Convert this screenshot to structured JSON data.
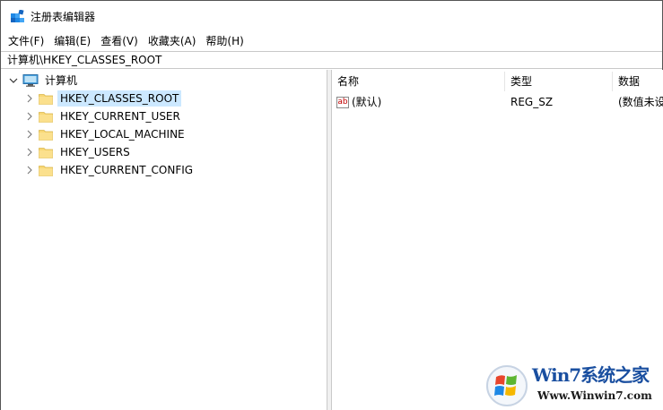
{
  "window": {
    "title": "注册表编辑器",
    "app_icon": "registry-editor-icon"
  },
  "menu": {
    "items": [
      {
        "label": "文件(F)"
      },
      {
        "label": "编辑(E)"
      },
      {
        "label": "查看(V)"
      },
      {
        "label": "收藏夹(A)"
      },
      {
        "label": "帮助(H)"
      }
    ]
  },
  "address": {
    "path": "计算机\\HKEY_CLASSES_ROOT"
  },
  "tree": {
    "root": {
      "label": "计算机",
      "icon": "computer-icon",
      "expanded": true
    },
    "nodes": [
      {
        "label": "HKEY_CLASSES_ROOT",
        "selected": true
      },
      {
        "label": "HKEY_CURRENT_USER",
        "selected": false
      },
      {
        "label": "HKEY_LOCAL_MACHINE",
        "selected": false
      },
      {
        "label": "HKEY_USERS",
        "selected": false
      },
      {
        "label": "HKEY_CURRENT_CONFIG",
        "selected": false
      }
    ]
  },
  "list": {
    "columns": {
      "name": "名称",
      "type": "类型",
      "data": "数据"
    },
    "rows": [
      {
        "icon": "string-value-icon",
        "icon_text": "ab",
        "name": "(默认)",
        "type": "REG_SZ",
        "data": "(数值未设置)"
      }
    ]
  },
  "watermark": {
    "brand": "Win7系统之家",
    "url": "Www.Winwin7.com"
  },
  "colors": {
    "selection": "#cce8ff",
    "folder": "#f8d775",
    "brand": "#1a4fa0"
  }
}
